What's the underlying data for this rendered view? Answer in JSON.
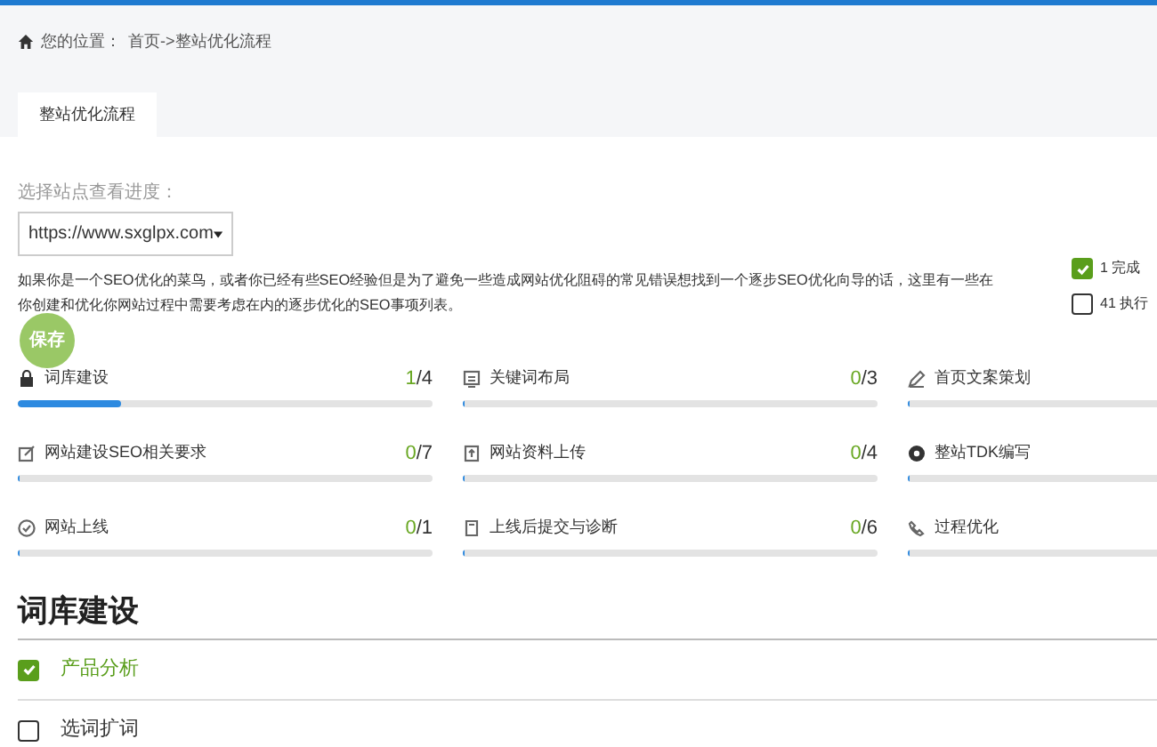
{
  "breadcrumb": {
    "label": "您的位置：",
    "path": "首页->整站优化流程"
  },
  "tabs": [
    {
      "label": "整站优化流程",
      "selected": true
    }
  ],
  "site_select": {
    "label": "选择站点查看进度：",
    "value": "https://www.sxglpx.com"
  },
  "legend": [
    {
      "label": "1 完成",
      "checked": true
    },
    {
      "label": "41 执行",
      "checked": false
    }
  ],
  "intro": "如果你是一个SEO优化的菜鸟，或者你已经有些SEO经验但是为了避免一些造成网站优化阻碍的常见错误想找到一个逐步SEO优化向导的话，这里有一些在你创建和优化你网站过程中需要考虑在内的逐步优化的SEO事项列表。",
  "save_button": "保存",
  "steps": [
    {
      "name": "词库建设",
      "done": "1",
      "rest": "/4",
      "level": 0.25
    },
    {
      "name": "关键词布局",
      "done": "0",
      "rest": "/3",
      "level": 0
    },
    {
      "name": "首页文案策划",
      "level": 0
    },
    {
      "name": "网站建设SEO相关要求",
      "done": "0",
      "rest": "/7",
      "level": 0
    },
    {
      "name": "网站资料上传",
      "done": "0",
      "rest": "/4",
      "level": 0
    },
    {
      "name": "整站TDK编写",
      "level": 0
    },
    {
      "name": "网站上线",
      "done": "0",
      "rest": "/1",
      "level": 0
    },
    {
      "name": "上线后提交与诊断",
      "done": "0",
      "rest": "/6",
      "level": 0
    },
    {
      "name": "过程优化",
      "level": 0
    }
  ],
  "section": {
    "title": "词库建设",
    "tasks": [
      {
        "label": "产品分析",
        "checked": true
      },
      {
        "label": "选词扩词",
        "checked": false
      }
    ]
  }
}
